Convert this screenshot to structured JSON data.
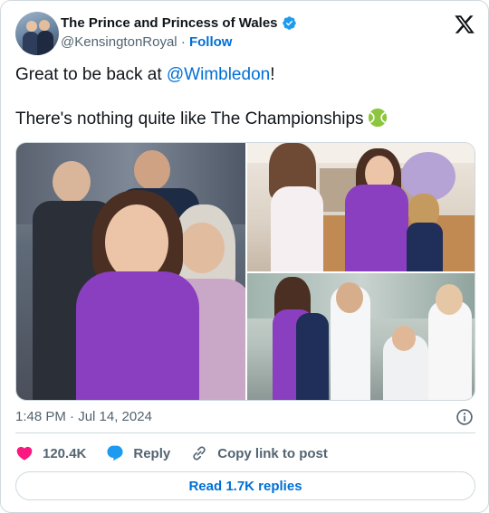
{
  "author": {
    "display_name": "The Prince and Princess of Wales",
    "handle": "@KensingtonRoyal",
    "separator": "·",
    "follow_label": "Follow"
  },
  "tweet": {
    "text_prefix": "Great to be back at ",
    "mention": "@Wimbledon",
    "text_suffix": "!",
    "line2": "There's nothing quite like The Championships"
  },
  "timestamp": "1:48 PM · Jul 14, 2024",
  "actions": {
    "like_count": "120.4K",
    "reply_label": "Reply",
    "copy_label": "Copy link to post"
  },
  "read_replies_label": "Read 1.7K replies",
  "colors": {
    "link": "#006fd6",
    "like": "#f91880",
    "reply": "#1d9bf0",
    "purple_dress": "#8a3fc0"
  },
  "icons": [
    "verified-badge-icon",
    "x-logo-icon",
    "tennis-ball-emoji",
    "info-icon",
    "heart-icon",
    "reply-bubble-icon",
    "link-icon"
  ]
}
